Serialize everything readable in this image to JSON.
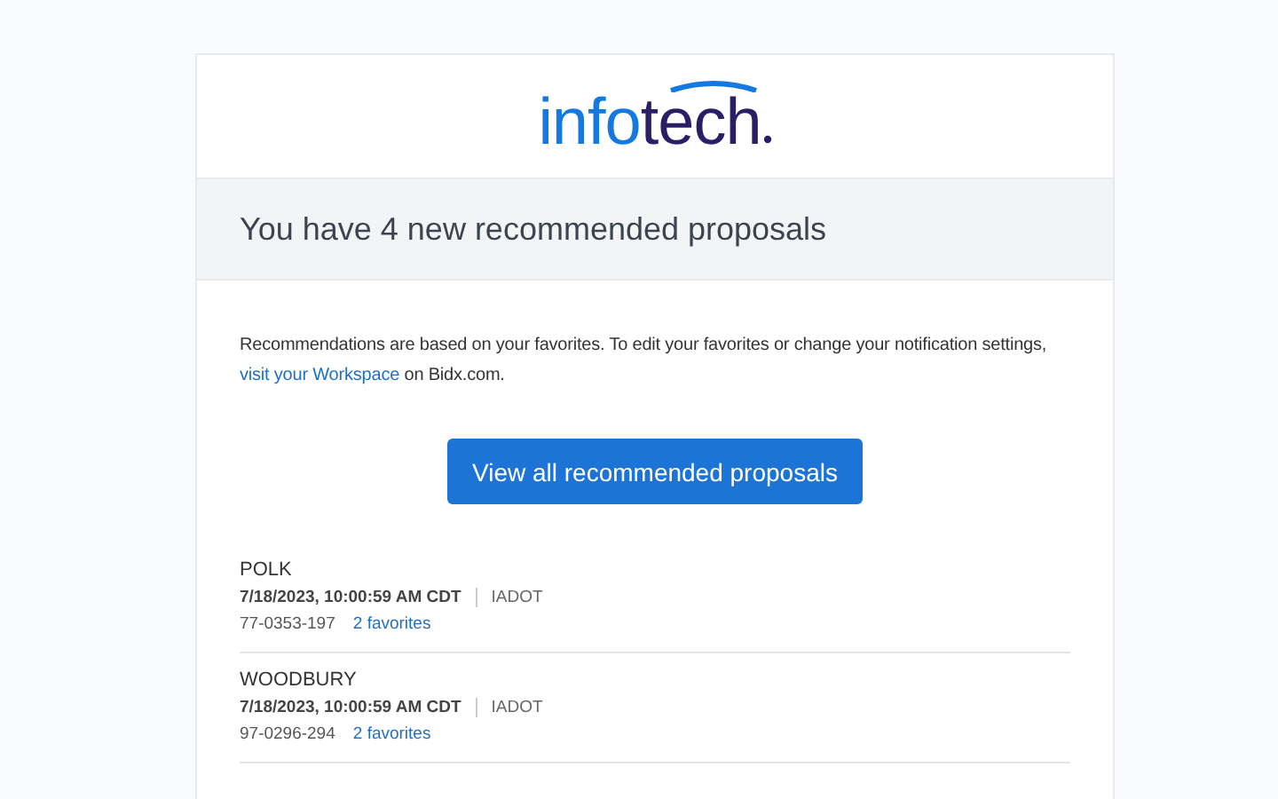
{
  "logo": {
    "first": "info",
    "second": "tech"
  },
  "heading": "You have 4 new recommended proposals",
  "intro": {
    "text": "Recommendations are based on your favorites. To edit your favorites or change your notification settings, ",
    "link": "visit your Workspace",
    "after": " on Bidx.com."
  },
  "button": "View all recommended proposals",
  "proposals": [
    {
      "county": "POLK",
      "date": "7/18/2023, 10:00:59 AM CDT",
      "agency": "IADOT",
      "number": "77-0353-197",
      "favorites": "2 favorites"
    },
    {
      "county": "WOODBURY",
      "date": "7/18/2023, 10:00:59 AM CDT",
      "agency": "IADOT",
      "number": "97-0296-294",
      "favorites": "2 favorites"
    }
  ]
}
